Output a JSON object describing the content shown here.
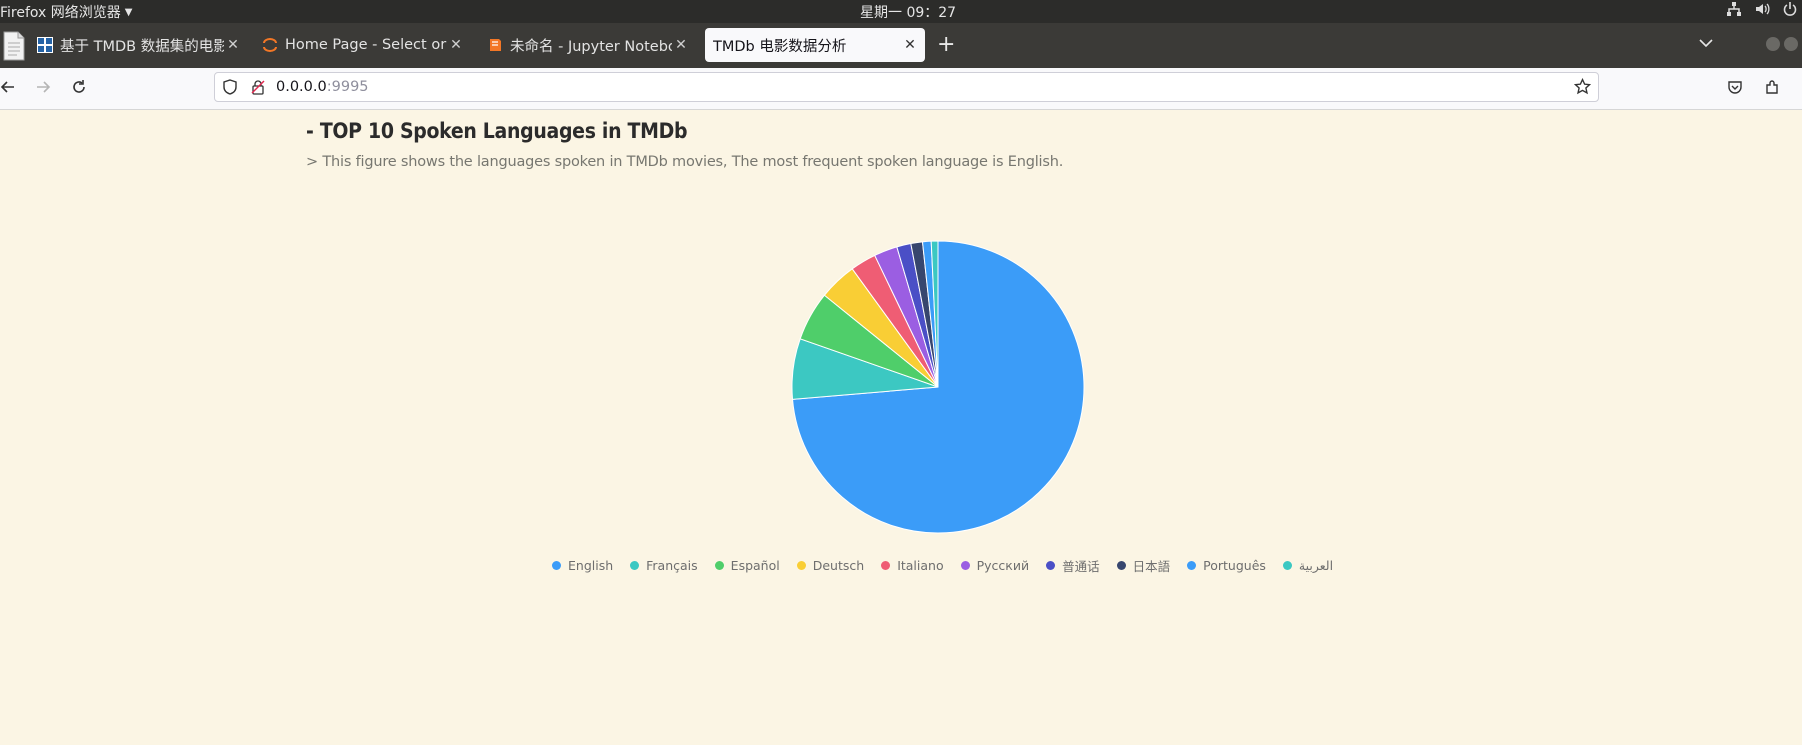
{
  "system_bar": {
    "app_menu_label": "Firefox 网络浏览器",
    "clock": "星期一 09：27"
  },
  "browser": {
    "tabs": [
      {
        "label": "基于 TMDB 数据集的电影",
        "favicon": "grid-icon",
        "active": false
      },
      {
        "label": "Home Page - Select or cr",
        "favicon": "jupyter-icon",
        "active": false
      },
      {
        "label": "未命名 - Jupyter Notebo",
        "favicon": "notebook-icon",
        "active": false
      },
      {
        "label": "TMDb 电影数据分析",
        "favicon": "",
        "active": true
      }
    ],
    "url_host": "0.0.0.0",
    "url_port": ":9995"
  },
  "page": {
    "heading": "- TOP 10 Spoken Languages in TMDb",
    "subtitle": "> This figure shows the languages spoken in TMDb movies, The most frequent spoken language is English."
  },
  "chart_data": {
    "type": "pie",
    "title": "",
    "legend_position": "bottom",
    "slices": [
      {
        "label": "English",
        "value": 0.7437,
        "color": "#3b9cf8"
      },
      {
        "label": "Français",
        "value": 0.0677,
        "color": "#3cc8c2"
      },
      {
        "label": "Español",
        "value": 0.0552,
        "color": "#4fce6a"
      },
      {
        "label": "Deutsch",
        "value": 0.0423,
        "color": "#f9ce35"
      },
      {
        "label": "Italiano",
        "value": 0.0289,
        "color": "#ef5d74"
      },
      {
        "label": "Русский",
        "value": 0.0261,
        "color": "#9b5ee2"
      },
      {
        "label": "普通话",
        "value": 0.0158,
        "color": "#4a4fc6"
      },
      {
        "label": "日本語",
        "value": 0.013,
        "color": "#37466e"
      },
      {
        "label": "Português",
        "value": 0.0096,
        "color": "#3b9cf8"
      },
      {
        "label": "العربية",
        "value": 0.0075,
        "color": "#3cc8c2"
      }
    ]
  }
}
